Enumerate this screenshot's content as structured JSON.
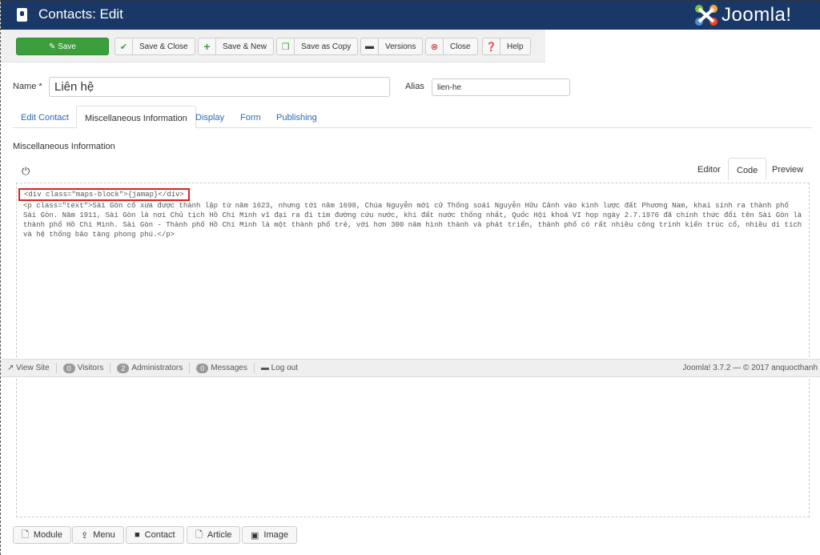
{
  "header": {
    "title": "Contacts: Edit",
    "logo": "Joomla!"
  },
  "toolbar": [
    {
      "label": "Save",
      "icon": "edit-icon"
    },
    {
      "label": "Save & Close",
      "icon": "check-icon"
    },
    {
      "label": "Save & New",
      "icon": "plus-icon"
    },
    {
      "label": "Save as Copy",
      "icon": "copy-icon"
    },
    {
      "label": "Versions",
      "icon": "archive-icon"
    },
    {
      "label": "Close",
      "icon": "close-icon"
    },
    {
      "label": "Help",
      "icon": "help-icon"
    }
  ],
  "form": {
    "name_label": "Name *",
    "name_value": "Liên hệ",
    "alias_label": "Alias",
    "alias_value": "lien-he"
  },
  "tabs": [
    "Edit Contact",
    "Miscellaneous Information",
    "Display",
    "Form",
    "Publishing"
  ],
  "section_label": "Miscellaneous Information",
  "editor_tabs": [
    "Editor",
    "Code",
    "Preview"
  ],
  "code": {
    "line1": "<div class=\"maps-block\">{jamap}</div>",
    "line2": "<p class=\"text\">Sài Gòn cổ xưa được thành lập từ năm 1623, nhưng tới năm 1698, Chúa Nguyễn mới cử Thống soái Nguyễn Hữu Cảnh vào kinh lược đất Phương Nam, khai sinh ra thành phố Sài Gòn. Năm 1911, Sài Gòn là nơi Chủ tịch Hồ Chí Minh vĩ đại ra đi tìm đường cứu nước, khi đất nước thống nhất, Quốc Hội khoá VI họp ngày 2.7.1976 đã chính thức đổi tên Sài Gòn là thành phố Hồ Chí Minh. Sài Gòn - Thành phố Hồ Chí Minh là một thành phố trẻ, với hơn 300 năm hình thành và phát triển, thành phố có rất nhiều công trình kiến trúc cổ, nhiều di tích và hệ thống bảo tàng phong phú.</p>"
  },
  "status": {
    "view_site": "View Site",
    "visitors_count": "0",
    "visitors": "Visitors",
    "admins_count": "2",
    "admins": "Administrators",
    "messages_count": "0",
    "messages": "Messages",
    "logout": "Log out",
    "version": "Joomla! 3.7.2 — © 2017 anquocthanh"
  },
  "bottom_buttons": [
    "Module",
    "Menu",
    "Contact",
    "Article",
    "Image"
  ],
  "colors": {
    "header": "#1a3867",
    "save": "#3d9e3d",
    "link": "#2a69b8",
    "highlight": "#e02020"
  }
}
